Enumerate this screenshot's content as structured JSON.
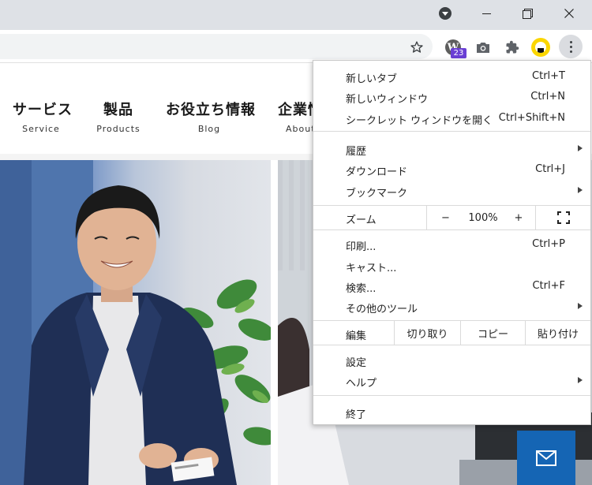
{
  "window": {
    "icons": {
      "profile_dropdown": "dropdown-circle-icon",
      "minimize": "minimize-icon",
      "restore": "restore-icon",
      "close": "close-icon"
    }
  },
  "toolbar": {
    "icons": {
      "bookmark": "star-icon",
      "wordpress": "wordpress-icon",
      "camera": "camera-icon",
      "extensions": "puzzle-icon",
      "profile": "profile-icon",
      "menu": "kebab-menu-icon"
    },
    "wordpress_badge": "23",
    "colors": {
      "badge": "#6a3fd4",
      "profile_ring": "#fbd600"
    }
  },
  "site": {
    "nav": [
      {
        "jp": "サービス",
        "en": "Service"
      },
      {
        "jp": "製品",
        "en": "Products"
      },
      {
        "jp": "お役立ち情報",
        "en": "Blog"
      },
      {
        "jp": "企業情報",
        "en": "About"
      }
    ],
    "mail_icon": "mail-icon",
    "colors": {
      "mail_button": "#1565b4"
    }
  },
  "menu": {
    "new_tab": {
      "label": "新しいタブ",
      "shortcut": "Ctrl+T"
    },
    "new_window": {
      "label": "新しいウィンドウ",
      "shortcut": "Ctrl+N"
    },
    "incognito": {
      "label": "シークレット ウィンドウを開く",
      "shortcut": "Ctrl+Shift+N"
    },
    "history": {
      "label": "履歴"
    },
    "downloads": {
      "label": "ダウンロード",
      "shortcut": "Ctrl+J"
    },
    "bookmarks": {
      "label": "ブックマーク"
    },
    "zoom": {
      "label": "ズーム",
      "minus": "−",
      "value": "100%",
      "plus": "+",
      "fullscreen_icon": "fullscreen-icon"
    },
    "print": {
      "label": "印刷...",
      "shortcut": "Ctrl+P"
    },
    "cast": {
      "label": "キャスト..."
    },
    "find": {
      "label": "検索...",
      "shortcut": "Ctrl+F"
    },
    "more_tools": {
      "label": "その他のツール"
    },
    "edit": {
      "label": "編集",
      "cut": "切り取り",
      "copy": "コピー",
      "paste": "貼り付け"
    },
    "settings": {
      "label": "設定"
    },
    "help": {
      "label": "ヘルプ"
    },
    "exit": {
      "label": "終了"
    }
  }
}
